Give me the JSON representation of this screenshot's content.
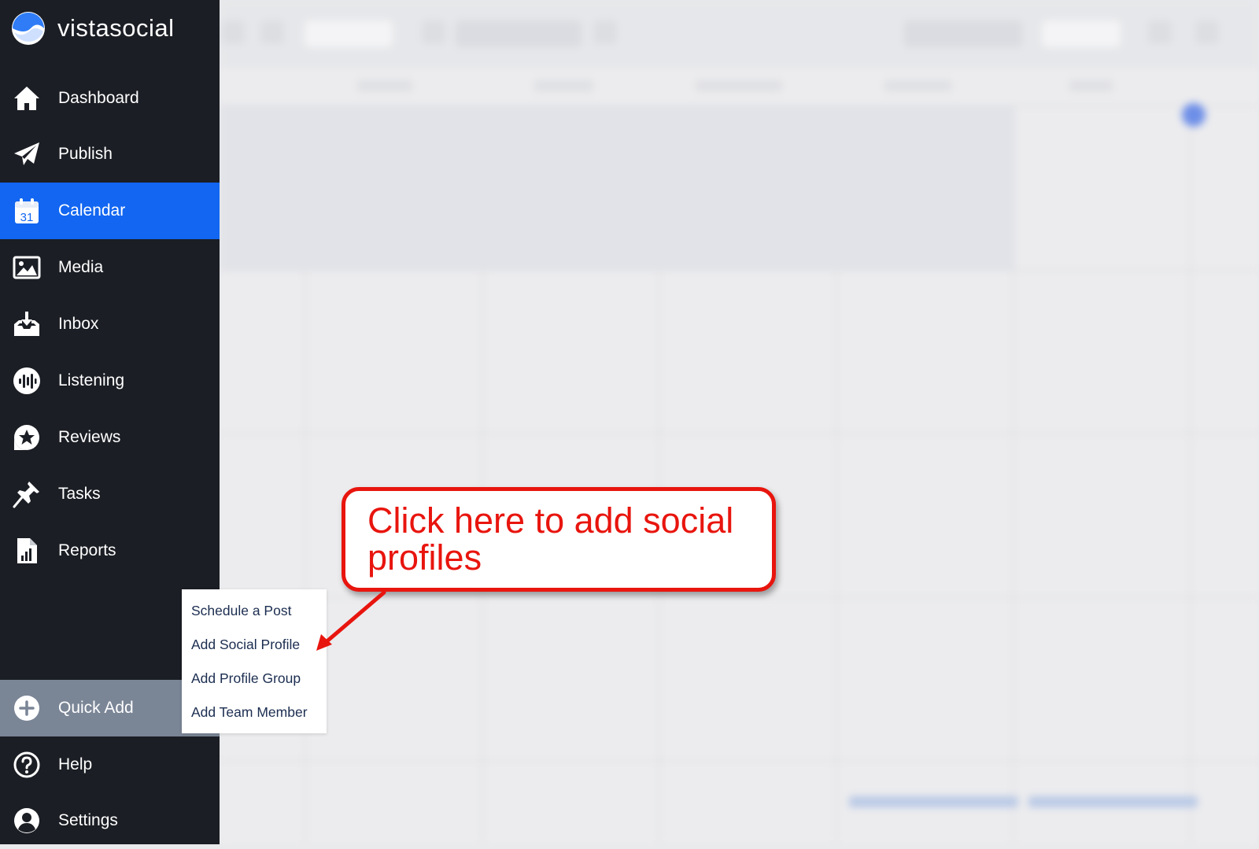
{
  "brand": {
    "name": "vistasocial"
  },
  "nav": {
    "items": [
      {
        "label": "Dashboard",
        "icon": "home-icon"
      },
      {
        "label": "Publish",
        "icon": "paper-plane-icon"
      },
      {
        "label": "Calendar",
        "icon": "calendar-icon",
        "active": true,
        "icon_text": "31"
      },
      {
        "label": "Media",
        "icon": "image-icon"
      },
      {
        "label": "Inbox",
        "icon": "inbox-icon"
      },
      {
        "label": "Listening",
        "icon": "audio-wave-icon"
      },
      {
        "label": "Reviews",
        "icon": "star-badge-icon"
      },
      {
        "label": "Tasks",
        "icon": "pushpin-icon"
      },
      {
        "label": "Reports",
        "icon": "report-icon"
      }
    ],
    "quick_add": {
      "label": "Quick Add",
      "icon": "plus-circle-icon"
    },
    "help": {
      "label": "Help",
      "icon": "question-circle-icon"
    },
    "settings": {
      "label": "Settings",
      "icon": "user-circle-icon"
    }
  },
  "quick_add_menu": {
    "items": [
      "Schedule a Post",
      "Add Social Profile",
      "Add Profile Group",
      "Add Team Member"
    ]
  },
  "callout": {
    "text": "Click here to add social profiles"
  },
  "colors": {
    "sidebar_bg": "#1b1e24",
    "active_nav": "#1266f1",
    "quick_add_bg": "#7a8596",
    "callout_red": "#e8150e",
    "menu_text": "#1b2d50"
  }
}
